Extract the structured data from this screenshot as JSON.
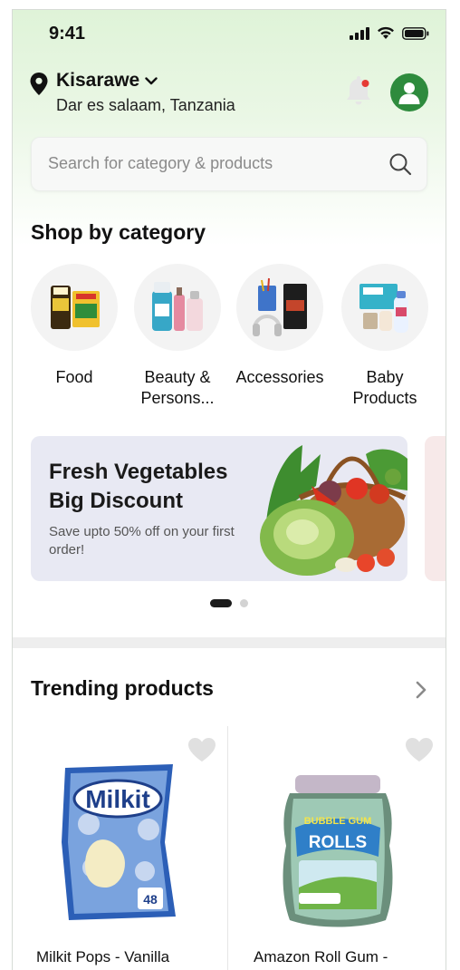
{
  "status_bar": {
    "time": "9:41"
  },
  "location": {
    "city": "Kisarawe",
    "region": "Dar es salaam, Tanzania"
  },
  "search": {
    "placeholder": "Search for category & products"
  },
  "categories_section": {
    "title": "Shop by category",
    "items": [
      {
        "label": "Food"
      },
      {
        "label": "Beauty & Persons..."
      },
      {
        "label": "Accessories"
      },
      {
        "label": "Baby Products"
      }
    ]
  },
  "banner": {
    "title": "Fresh Vegetables Big Discount",
    "subtitle": "Save upto 50% off on your first order!",
    "slide_index": 1,
    "slide_count": 2
  },
  "trending": {
    "title": "Trending products",
    "products": [
      {
        "name": "Milkit Pops - Vanilla"
      },
      {
        "name": "Amazon Roll Gum -"
      }
    ]
  },
  "colors": {
    "brand_green": "#2e8b3d",
    "notification_dot": "#e53935",
    "banner_bg": "#e8e9f3"
  },
  "icons": [
    "location-pin-icon",
    "chevron-down-icon",
    "bell-icon",
    "user-icon",
    "search-icon",
    "chevron-right-icon",
    "heart-icon"
  ]
}
